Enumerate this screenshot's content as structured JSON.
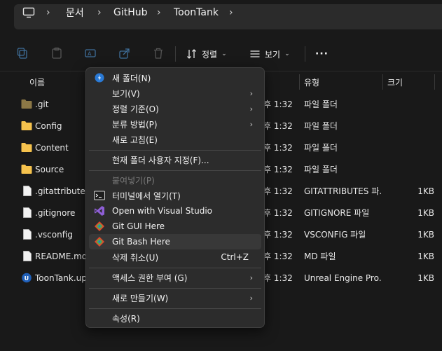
{
  "breadcrumb": {
    "items": [
      "문서",
      "GitHub",
      "ToonTank"
    ]
  },
  "toolbar": {
    "sort_label": "정렬",
    "view_label": "보기",
    "more_label": "···"
  },
  "columns": {
    "name": "이름",
    "type": "유형",
    "size": "크기"
  },
  "files": [
    {
      "name": ".git",
      "date": "후 1:32",
      "type": "파일 폴더",
      "size": "",
      "kind": "folder-dim"
    },
    {
      "name": "Config",
      "date": "후 1:32",
      "type": "파일 폴더",
      "size": "",
      "kind": "folder"
    },
    {
      "name": "Content",
      "date": "후 1:32",
      "type": "파일 폴더",
      "size": "",
      "kind": "folder"
    },
    {
      "name": "Source",
      "date": "후 1:32",
      "type": "파일 폴더",
      "size": "",
      "kind": "folder"
    },
    {
      "name": ".gitattributes",
      "date": "후 1:32",
      "type": "GITATTRIBUTES 파...",
      "size": "1KB",
      "kind": "file"
    },
    {
      "name": ".gitignore",
      "date": "후 1:32",
      "type": "GITIGNORE 파일",
      "size": "1KB",
      "kind": "file"
    },
    {
      "name": ".vsconfig",
      "date": "후 1:32",
      "type": "VSCONFIG 파일",
      "size": "1KB",
      "kind": "file"
    },
    {
      "name": "README.md",
      "date": "후 1:32",
      "type": "MD 파일",
      "size": "1KB",
      "kind": "file"
    },
    {
      "name": "ToonTank.upr",
      "date": "후 1:32",
      "type": "Unreal Engine Pro...",
      "size": "1KB",
      "kind": "unreal"
    }
  ],
  "menu": {
    "new_folder": "새 폴더(N)",
    "view": "보기(V)",
    "sort_by": "정렬 기준(O)",
    "group_by": "분류 방법(P)",
    "refresh": "새로 고침(E)",
    "customize": "현재 폴더 사용자 지정(F)...",
    "paste": "붙여넣기(P)",
    "open_terminal": "터미널에서 열기(T)",
    "open_vs": "Open with Visual Studio",
    "git_gui": "Git GUI Here",
    "git_bash": "Git Bash Here",
    "undo_delete": "삭제 취소(U)",
    "undo_shortcut": "Ctrl+Z",
    "give_access": "액세스 권한 부여 (G)",
    "new": "새로 만들기(W)",
    "properties": "속성(R)"
  }
}
